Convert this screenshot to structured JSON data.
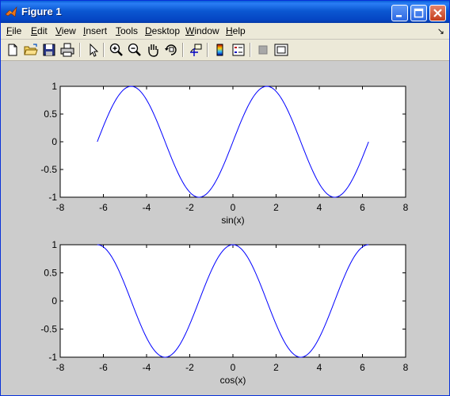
{
  "window": {
    "title": "Figure 1",
    "title_color": "#ffffff",
    "frame_color": "#0546c4",
    "figure_bg": "#cccccc"
  },
  "menubar": {
    "items": [
      {
        "label": "File",
        "mnemonic": "F",
        "rest": "ile"
      },
      {
        "label": "Edit",
        "mnemonic": "E",
        "rest": "dit"
      },
      {
        "label": "View",
        "mnemonic": "V",
        "rest": "iew"
      },
      {
        "label": "Insert",
        "mnemonic": "I",
        "rest": "nsert"
      },
      {
        "label": "Tools",
        "mnemonic": "T",
        "rest": "ools"
      },
      {
        "label": "Desktop",
        "mnemonic": "D",
        "rest": "esktop"
      },
      {
        "label": "Window",
        "mnemonic": "W",
        "rest": "indow"
      },
      {
        "label": "Help",
        "mnemonic": "H",
        "rest": "elp"
      }
    ],
    "dock_glyph": "↘"
  },
  "toolbar": {
    "icons": [
      "new-file-icon",
      "open-folder-icon",
      "save-icon",
      "print-icon",
      "pointer-arrow-icon",
      "zoom-in-icon",
      "zoom-out-icon",
      "pan-hand-icon",
      "rotate-3d-icon",
      "data-cursor-icon",
      "colorbar-icon",
      "legend-icon",
      "hide-plot-tools-icon",
      "show-plot-tools-icon"
    ]
  },
  "chart_data": [
    {
      "type": "line",
      "xlabel": "sin(x)",
      "ylabel": "",
      "title": "",
      "xlim": [
        -8,
        8
      ],
      "ylim": [
        -1,
        1
      ],
      "xticks": [
        "-8",
        "-6",
        "-4",
        "-2",
        "0",
        "2",
        "4",
        "6",
        "8"
      ],
      "yticks": [
        "1",
        "0.5",
        "0",
        "-0.5",
        "-1"
      ],
      "grid": false,
      "line_color": "#0000ff",
      "x_range": [
        -6.2832,
        6.2832
      ],
      "function": "sin",
      "series": [
        {
          "x": [
            -6.28,
            -4.71,
            -3.14,
            -1.57,
            0,
            1.57,
            3.14,
            4.71,
            6.28
          ],
          "y": [
            0,
            1,
            0,
            -1,
            0,
            1,
            0,
            -1,
            0
          ]
        }
      ]
    },
    {
      "type": "line",
      "xlabel": "cos(x)",
      "ylabel": "",
      "title": "",
      "xlim": [
        -8,
        8
      ],
      "ylim": [
        -1,
        1
      ],
      "xticks": [
        "-8",
        "-6",
        "-4",
        "-2",
        "0",
        "2",
        "4",
        "6",
        "8"
      ],
      "yticks": [
        "1",
        "0.5",
        "0",
        "-0.5",
        "-1"
      ],
      "grid": false,
      "line_color": "#0000ff",
      "x_range": [
        -6.2832,
        6.2832
      ],
      "function": "cos",
      "series": [
        {
          "x": [
            -6.28,
            -4.71,
            -3.14,
            -1.57,
            0,
            1.57,
            3.14,
            4.71,
            6.28
          ],
          "y": [
            1,
            0,
            -1,
            0,
            1,
            0,
            -1,
            0,
            1
          ]
        }
      ]
    }
  ]
}
